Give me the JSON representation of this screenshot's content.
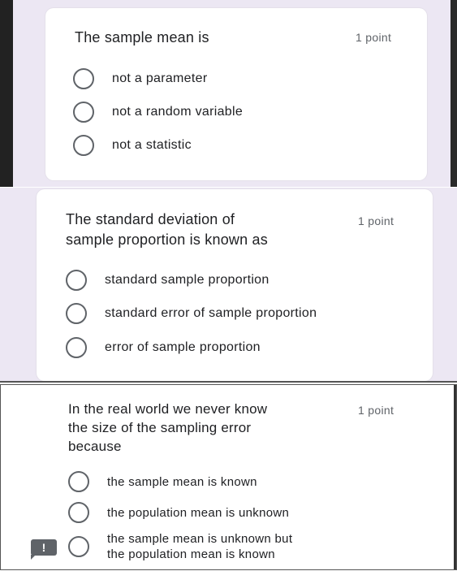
{
  "questions": [
    {
      "title": "The sample mean is",
      "points": "1 point",
      "options": [
        "not a parameter",
        "not a random variable",
        "not a statistic"
      ]
    },
    {
      "title_lines": [
        "The standard deviation of",
        "sample proportion is known as"
      ],
      "points": "1 point",
      "options": [
        "standard sample proportion",
        "standard error of sample proportion",
        "error of sample proportion"
      ]
    },
    {
      "title_lines": [
        "In the real world we never know",
        "the size of the sampling error",
        "because"
      ],
      "points": "1 point",
      "options": [
        "the sample mean is known",
        "the population mean is unknown",
        [
          "the sample mean is unknown but",
          "the population mean is known"
        ]
      ]
    }
  ],
  "feedback_icon": "feedback-icon",
  "colors": {
    "background": "#ece7f3",
    "text": "#202124",
    "muted": "#5f6368"
  }
}
